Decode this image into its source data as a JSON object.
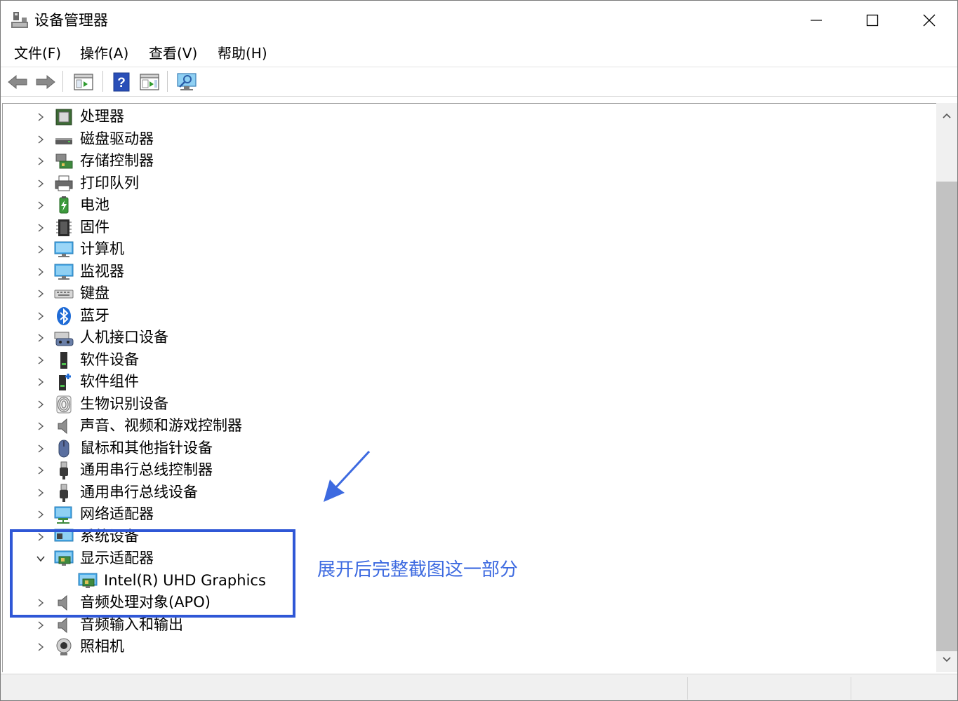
{
  "window": {
    "title": "设备管理器"
  },
  "menu": [
    {
      "label": "文件(F)"
    },
    {
      "label": "操作(A)"
    },
    {
      "label": "查看(V)"
    },
    {
      "label": "帮助(H)"
    }
  ],
  "toolbar": {
    "buttons": [
      "back-icon",
      "forward-icon",
      "properties-icon",
      "help-icon",
      "view-icon",
      "scan-hardware-icon"
    ]
  },
  "tree": {
    "nodes": [
      {
        "label": "处理器",
        "icon": "processor-icon",
        "expanded": false
      },
      {
        "label": "磁盘驱动器",
        "icon": "disk-drive-icon",
        "expanded": false
      },
      {
        "label": "存储控制器",
        "icon": "storage-controller-icon",
        "expanded": false
      },
      {
        "label": "打印队列",
        "icon": "printer-icon",
        "expanded": false
      },
      {
        "label": "电池",
        "icon": "battery-icon",
        "expanded": false
      },
      {
        "label": "固件",
        "icon": "firmware-icon",
        "expanded": false
      },
      {
        "label": "计算机",
        "icon": "computer-icon",
        "expanded": false
      },
      {
        "label": "监视器",
        "icon": "monitor-icon",
        "expanded": false
      },
      {
        "label": "键盘",
        "icon": "keyboard-icon",
        "expanded": false
      },
      {
        "label": "蓝牙",
        "icon": "bluetooth-icon",
        "expanded": false
      },
      {
        "label": "人机接口设备",
        "icon": "hid-icon",
        "expanded": false
      },
      {
        "label": "软件设备",
        "icon": "software-device-icon",
        "expanded": false
      },
      {
        "label": "软件组件",
        "icon": "software-component-icon",
        "expanded": false
      },
      {
        "label": "生物识别设备",
        "icon": "biometric-icon",
        "expanded": false
      },
      {
        "label": "声音、视频和游戏控制器",
        "icon": "sound-icon",
        "expanded": false
      },
      {
        "label": "鼠标和其他指针设备",
        "icon": "mouse-icon",
        "expanded": false
      },
      {
        "label": "通用串行总线控制器",
        "icon": "usb-controller-icon",
        "expanded": false
      },
      {
        "label": "通用串行总线设备",
        "icon": "usb-device-icon",
        "expanded": false
      },
      {
        "label": "网络适配器",
        "icon": "network-adapter-icon",
        "expanded": false
      },
      {
        "label": "系统设备",
        "icon": "system-device-icon",
        "expanded": false
      },
      {
        "label": "显示适配器",
        "icon": "display-adapter-icon",
        "expanded": true
      },
      {
        "label": "Intel(R) UHD Graphics",
        "icon": "display-adapter-icon",
        "child": true
      },
      {
        "label": "音频处理对象(APO)",
        "icon": "audio-apo-icon",
        "expanded": false
      },
      {
        "label": "音频输入和输出",
        "icon": "audio-io-icon",
        "expanded": false
      },
      {
        "label": "照相机",
        "icon": "camera-icon",
        "expanded": false
      }
    ]
  },
  "annotation": {
    "text": "展开后完整截图这一部分",
    "color": "#3d6ae0",
    "box_color": "#2f57d6"
  }
}
